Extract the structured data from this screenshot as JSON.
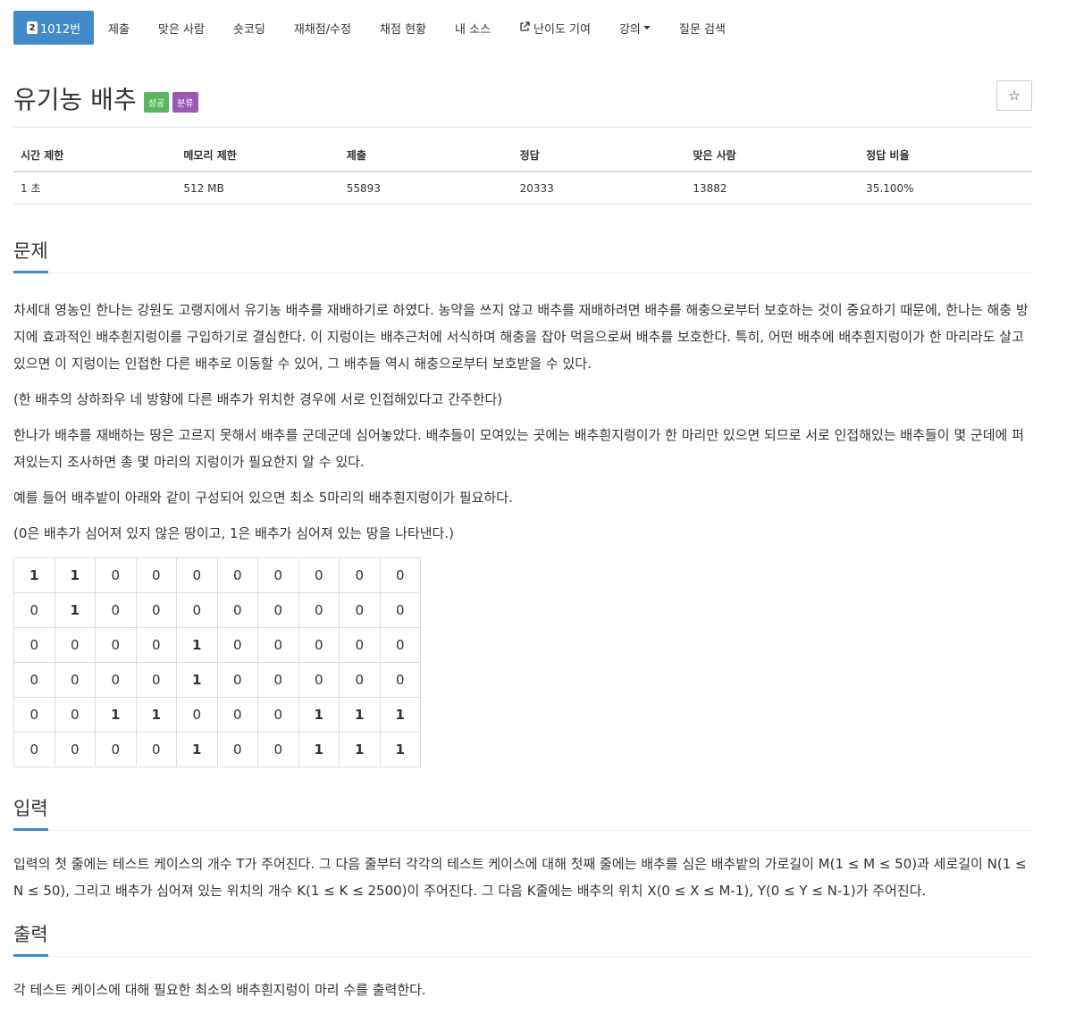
{
  "nav": {
    "problem_no": "1012번",
    "level_badge": "2",
    "items": [
      "제출",
      "맞은 사람",
      "숏코딩",
      "재채점/수정",
      "채점 현황",
      "내 소스",
      "난이도 기여",
      "강의",
      "질문 검색"
    ]
  },
  "problem": {
    "title": "유기농 배추",
    "label_success": "성공",
    "label_tag": "분류",
    "star": "☆"
  },
  "stats": {
    "headers": [
      "시간 제한",
      "메모리 제한",
      "제출",
      "정답",
      "맞은 사람",
      "정답 비율"
    ],
    "values": [
      "1 초",
      "512 MB",
      "55893",
      "20333",
      "13882",
      "35.100%"
    ]
  },
  "sections": {
    "problem_head": "문제",
    "p1": "차세대 영농인 한나는 강원도 고랭지에서 유기농 배추를 재배하기로 하였다. 농약을 쓰지 않고 배추를 재배하려면 배추를 해충으로부터 보호하는 것이 중요하기 때문에, 한나는 해충 방지에 효과적인 배추흰지렁이를 구입하기로 결심한다. 이 지렁이는 배추근처에 서식하며 해충을 잡아 먹음으로써 배추를 보호한다. 특히, 어떤 배추에 배추흰지렁이가 한 마리라도 살고 있으면 이 지렁이는 인접한 다른 배추로 이동할 수 있어, 그 배추들 역시 해충으로부터 보호받을 수 있다.",
    "p2": "(한 배추의 상하좌우 네 방향에 다른 배추가 위치한 경우에 서로 인접해있다고 간주한다)",
    "p3": "한나가 배추를 재배하는 땅은 고르지 못해서 배추를 군데군데 심어놓았다. 배추들이 모여있는 곳에는 배추흰지렁이가 한 마리만 있으면 되므로 서로 인접해있는 배추들이 몇 군데에 퍼져있는지 조사하면 총 몇 마리의 지렁이가 필요한지 알 수 있다.",
    "p4": "예를 들어 배추밭이 아래와 같이 구성되어 있으면 최소 5마리의 배추흰지렁이가 필요하다.",
    "p5": "(0은 배추가 심어져 있지 않은 땅이고, 1은 배추가 심어져 있는 땅을 나타낸다.)",
    "input_head": "입력",
    "input_text": "입력의 첫 줄에는 테스트 케이스의 개수 T가 주어진다. 그 다음 줄부터 각각의 테스트 케이스에 대해 첫째 줄에는 배추를 심은 배추밭의 가로길이 M(1 ≤ M ≤ 50)과 세로길이 N(1 ≤ N ≤ 50), 그리고 배추가 심어져 있는 위치의 개수 K(1 ≤ K ≤ 2500)이 주어진다. 그 다음 K줄에는 배추의 위치 X(0 ≤ X ≤ M-1), Y(0 ≤ Y ≤ N-1)가 주어진다.",
    "output_head": "출력",
    "output_text": "각 테스트 케이스에 대해 필요한 최소의 배추흰지렁이 마리 수를 출력한다."
  },
  "grid": [
    [
      "1",
      "1",
      "0",
      "0",
      "0",
      "0",
      "0",
      "0",
      "0",
      "0"
    ],
    [
      "0",
      "1",
      "0",
      "0",
      "0",
      "0",
      "0",
      "0",
      "0",
      "0"
    ],
    [
      "0",
      "0",
      "0",
      "0",
      "1",
      "0",
      "0",
      "0",
      "0",
      "0"
    ],
    [
      "0",
      "0",
      "0",
      "0",
      "1",
      "0",
      "0",
      "0",
      "0",
      "0"
    ],
    [
      "0",
      "0",
      "1",
      "1",
      "0",
      "0",
      "0",
      "1",
      "1",
      "1"
    ],
    [
      "0",
      "0",
      "0",
      "0",
      "1",
      "0",
      "0",
      "1",
      "1",
      "1"
    ]
  ]
}
